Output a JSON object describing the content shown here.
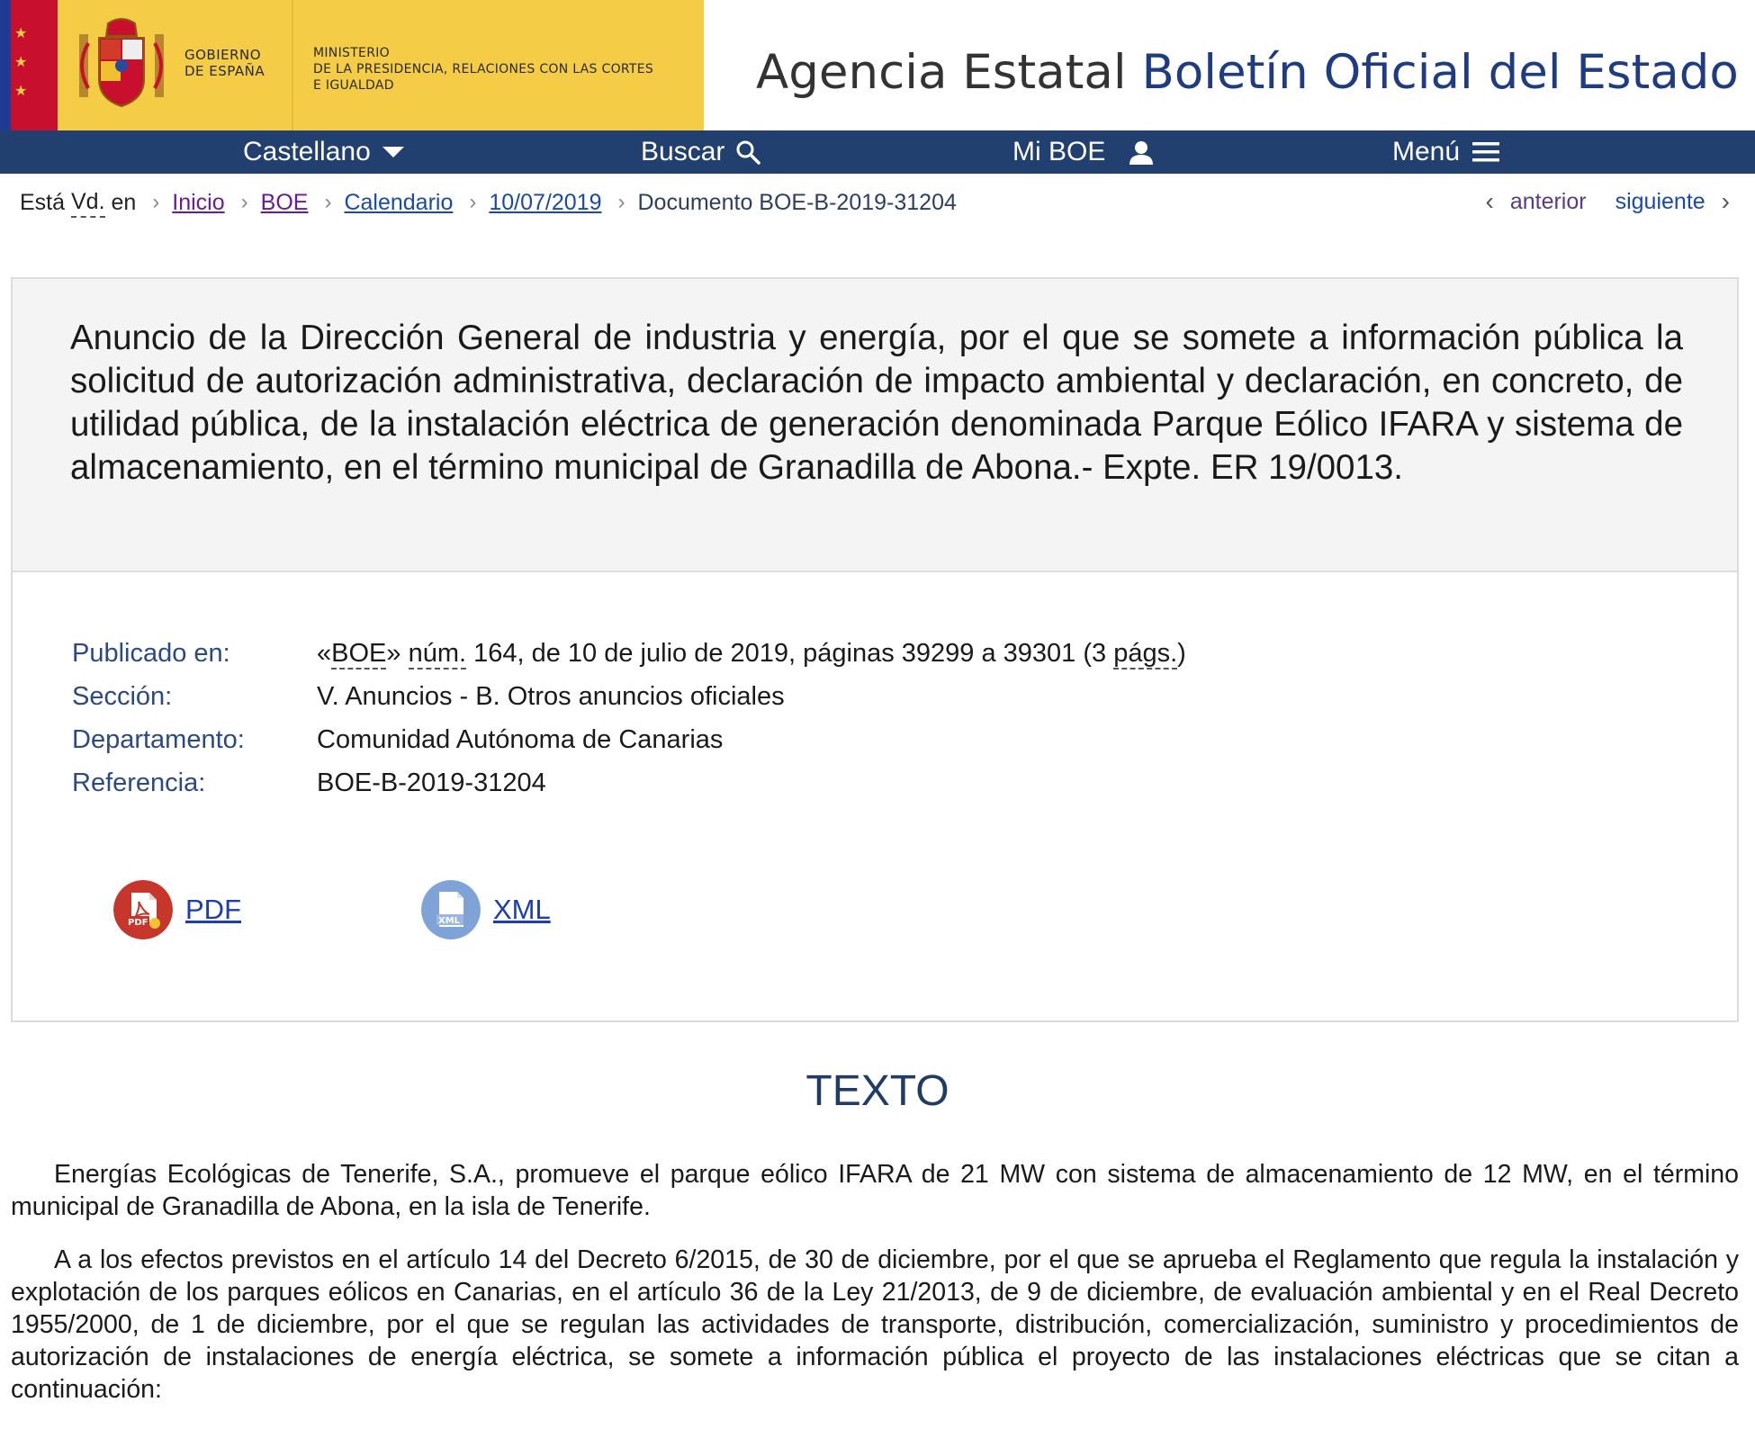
{
  "header": {
    "gobierno": [
      "GOBIERNO",
      "DE ESPAÑA"
    ],
    "ministerio": [
      "MINISTERIO",
      "DE LA PRESIDENCIA, RELACIONES CON LAS CORTES",
      "E IGUALDAD"
    ],
    "agency_prefix": "Agencia Estatal",
    "agency_name": "Boletín Oficial del Estado",
    "colors": {
      "yellow": "#f4cc45",
      "navy": "#21406f",
      "red": "#c8102e"
    }
  },
  "nav": {
    "language": "Castellano",
    "search": "Buscar",
    "my_boe": "Mi BOE",
    "menu": "Menú"
  },
  "breadcrumb": {
    "prefix_1": "Está",
    "prefix_abbr": "Vd.",
    "prefix_2": "en",
    "items": [
      "Inicio",
      "BOE",
      "Calendario",
      "10/07/2019"
    ],
    "current": "Documento BOE-B-2019-31204"
  },
  "pager": {
    "prev": "anterior",
    "next": "siguiente"
  },
  "document": {
    "title": "Anuncio de la Dirección General de industria y energía, por el que se somete a información pública la solicitud de autorización administrativa, declaración de impacto ambiental y declaración, en concreto, de utilidad pública, de la instalación eléctrica de generación denominada Parque Eólico IFARA y sistema de almacenamiento, en el término municipal de Granadilla de Abona.- Expte. ER 19/0013.",
    "meta": {
      "published_label": "Publicado en:",
      "published_q1": "«",
      "published_boe": "BOE",
      "published_q2": "» ",
      "published_num": "núm.",
      "published_mid": " 164, de 10 de julio de 2019, páginas 39299 a 39301 (3 ",
      "published_pags": "págs.",
      "published_end": ")",
      "section_label": "Sección:",
      "section_value": "V. Anuncios - B. Otros anuncios oficiales",
      "department_label": "Departamento:",
      "department_value": "Comunidad Autónoma de Canarias",
      "reference_label": "Referencia:",
      "reference_value": "BOE-B-2019-31204"
    },
    "downloads": {
      "pdf": "PDF",
      "xml": "XML",
      "pdf_icon_text": "PDF",
      "xml_icon_text": "XML"
    }
  },
  "texto": {
    "heading": "TEXTO",
    "paragraphs": [
      "Energías Ecológicas de Tenerife, S.A., promueve el parque eólico IFARA de 21 MW con sistema de almacenamiento de 12 MW, en el término municipal de Granadilla de Abona, en la isla de Tenerife.",
      "A a los efectos previstos en el artículo 14 del Decreto 6/2015, de 30 de diciembre, por el que se aprueba el Reglamento que regula la instalación y explotación de los parques eólicos en Canarias, en el artículo 36 de la Ley 21/2013, de 9 de diciembre, de evaluación ambiental y en el Real Decreto 1955/2000, de 1 de diciembre, por el que se regulan las actividades de transporte, distribución, comercialización, suministro y procedimientos de autorización de instalaciones de energía eléctrica, se somete a información pública el proyecto de las instalaciones eléctricas que se citan a continuación:"
    ]
  }
}
